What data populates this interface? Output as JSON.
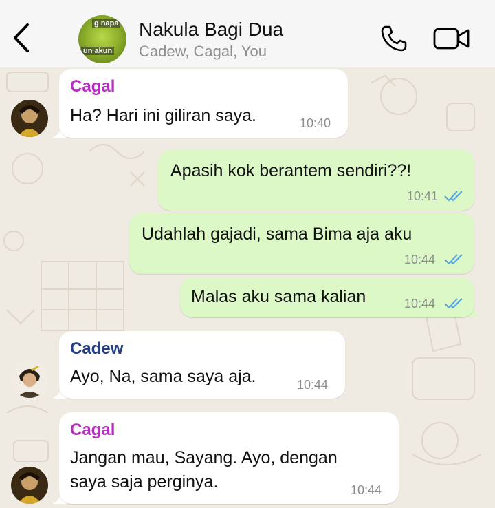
{
  "header": {
    "title": "Nakula Bagi Dua",
    "subtitle": "Cadew, Cagal, You",
    "avatar_caption_top": "g napa",
    "avatar_caption_bottom": "un akun"
  },
  "colors": {
    "header_bg": "#f6f6f6",
    "wallpaper": "#efeae2",
    "incoming_bubble": "#ffffff",
    "outgoing_bubble": "#dcf8c6",
    "cagal_name": "#b62fc1",
    "cadew_name": "#233f83",
    "read_ticks": "#4fa3e0"
  },
  "icons": [
    "back-chevron-icon",
    "phone-icon",
    "video-camera-icon",
    "double-check-icon"
  ],
  "messages": [
    {
      "sender": "Cagal",
      "text": "Ha? Hari ini giliran saya.",
      "time": "10:40"
    },
    {
      "text": "Apasih kok berantem sendiri??!",
      "time": "10:41"
    },
    {
      "text": "Udahlah gajadi, sama Bima aja aku",
      "time": "10:44"
    },
    {
      "text": "Malas aku sama kalian",
      "time": "10:44"
    },
    {
      "sender": "Cadew",
      "text": "Ayo, Na, sama saya aja.",
      "time": "10:44"
    },
    {
      "sender": "Cagal",
      "text_line1": "Jangan mau, Sayang. Ayo, dengan",
      "text_line2": "saya saja perginya.",
      "time": "10:44"
    }
  ]
}
